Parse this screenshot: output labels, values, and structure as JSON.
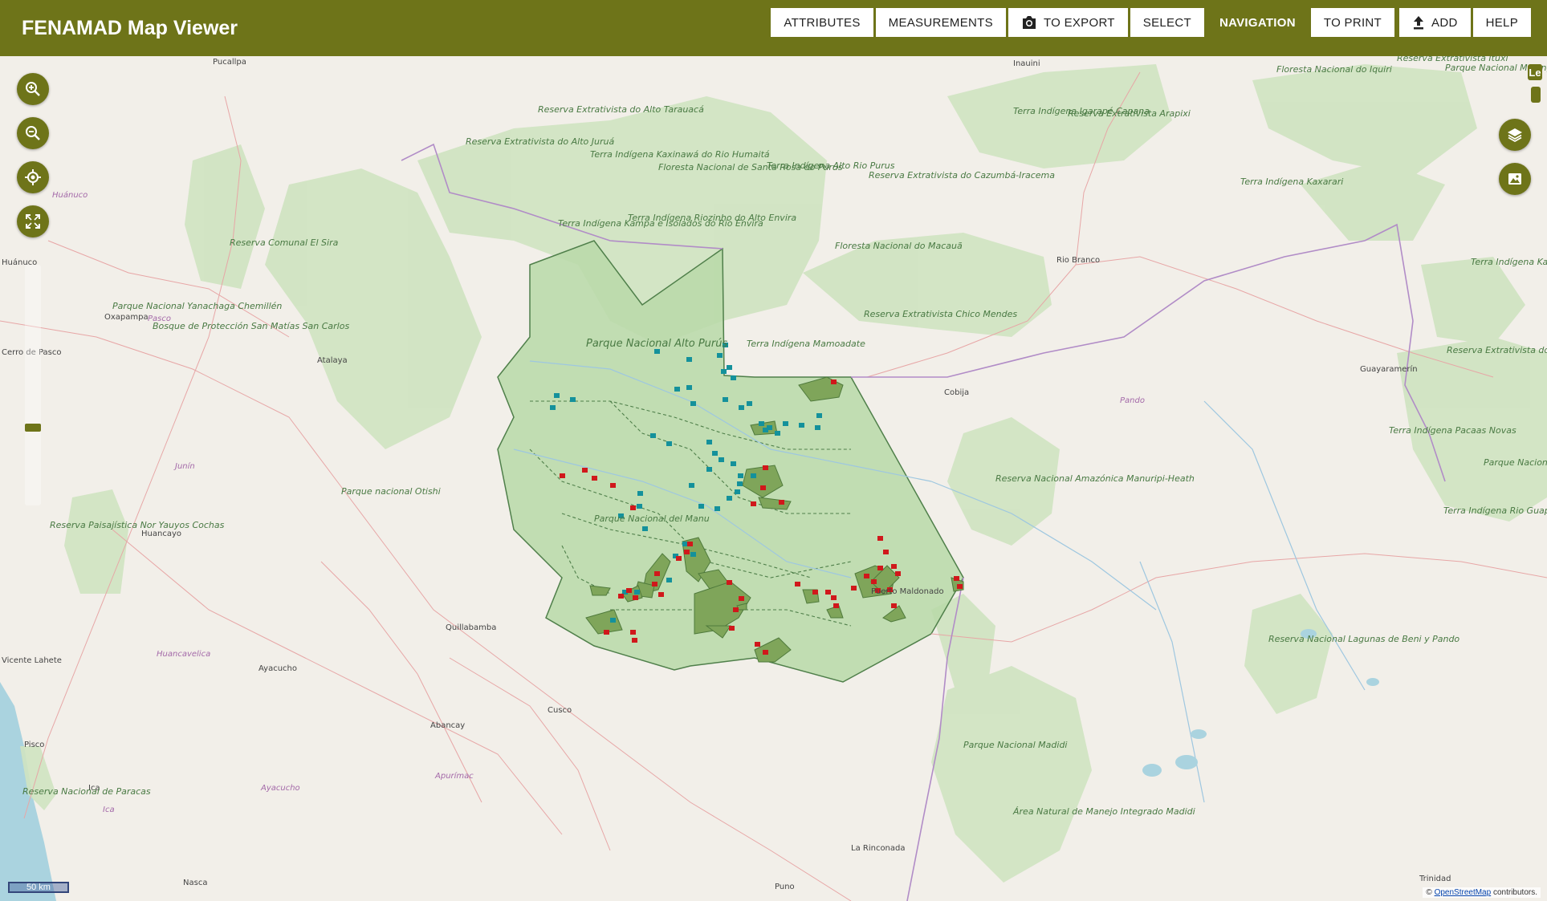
{
  "header": {
    "title": "FENAMAD Map Viewer",
    "buttons": {
      "attributes": "ATTRIBUTES",
      "measurements": "MEASUREMENTS",
      "export": "TO EXPORT",
      "select": "SELECT",
      "navigation": "NAVIGATION",
      "print": "TO PRINT",
      "add": "ADD",
      "help": "HELP"
    },
    "active_tool": "NAVIGATION"
  },
  "map": {
    "controls": [
      "zoom-in-icon",
      "zoom-out-icon",
      "locate-icon",
      "fullscreen-icon",
      "layers-icon",
      "basemap-icon"
    ],
    "legend_tab": "Le",
    "scale": "50 km",
    "attribution_prefix": "© ",
    "attribution_link": "OpenStreetMap",
    "attribution_suffix": " contributors.",
    "colors": {
      "accent": "#6e7419",
      "protected_area": "#a9cf9a",
      "territory": "#7fa55a",
      "marker_red": "#d0181b",
      "marker_teal": "#14919b"
    },
    "protected_area_labels": [
      "Parque Nacional Alto Purús",
      "Parque Nacional del Manu",
      "Reserva Nacional Amazónica Manuripi-Heath",
      "Reserva Extrativista Chico Mendes",
      "Reserva Extrativista do Alto Juruá",
      "Reserva Extrativista do Cazumbá-Iracema",
      "Parque Nacional Madidi",
      "Área Natural de Manejo Integrado Madidi",
      "Reserva Nacional Lagunas de Beni y Pando",
      "Reserva Comunal El Sira",
      "Parque Nacional Yanachaga Chemillén",
      "Bosque de Protección San Matías San Carlos",
      "Reserva Paisajística Nor Yauyos Cochas",
      "Parque nacional Otishi",
      "Reserva Nacional de Paracas",
      "Floresta Nacional do Iquiri",
      "Floresta Nacional do Macauã",
      "Terra Indígena Mamoadate",
      "Reserva Extrativista do Alto Tarauacá",
      "Terra Indígena Kaxinawá do Rio Humaitá",
      "Floresta Nacional de Santa Rosa do Purus",
      "Terra Indígena Alto Rio Purus",
      "Terra Indígena Kampa e Isolados do Rio Envira",
      "Terra Indígena Riozinho do Alto Envira",
      "Terra Indígena Igarapé Capana",
      "Reserva Extrativista Arapixi",
      "Terra Indígena Kaxarari",
      "Terra Indígena Karipuna",
      "Reserva Extrativista do Rio Ouro Preto",
      "Terra Indígena Pacaas Novas",
      "Parque Nacional Serra da Cutia",
      "Terra Indígena Rio Guaporé",
      "Reserva Extrativista Ituxi",
      "Parque Nacional Mapinguari"
    ],
    "cities": [
      "Pucallpa",
      "Huánuco",
      "Cerro de Pasco",
      "Oxapampa",
      "Atalaya",
      "Huancayo",
      "Quillabamba",
      "Ayacucho",
      "Cusco",
      "Abancay",
      "Pisco",
      "Ica",
      "Nasca",
      "Puno",
      "Puerto Maldonado",
      "Cobija",
      "Rio Branco",
      "Guayaramerín",
      "La Rinconada",
      "Trinidad",
      "Inauini",
      "Vicente Lahete"
    ],
    "regions": [
      "Junín",
      "Huancavelica",
      "Apurímac",
      "Ayacucho",
      "Ica",
      "Pando",
      "Huánuco",
      "Pasco"
    ]
  }
}
